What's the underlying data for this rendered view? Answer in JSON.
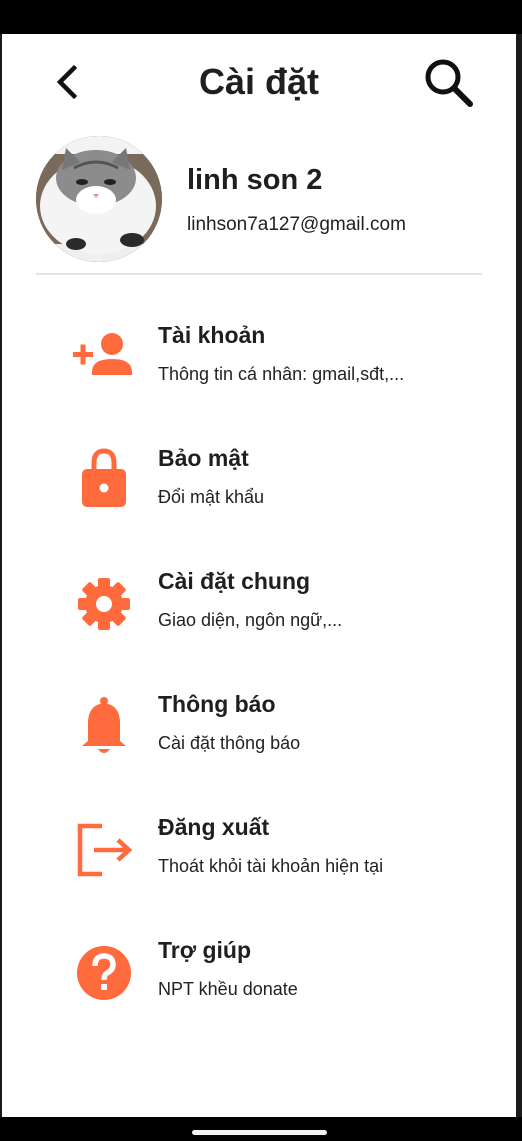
{
  "header": {
    "title": "Cài đặt",
    "back_icon": "back-arrow-icon",
    "search_icon": "search-icon"
  },
  "profile": {
    "name": "linh son 2",
    "email": "linhson7a127@gmail.com",
    "avatar": "cat-photo"
  },
  "accent_color": "#ff6b3d",
  "menu": {
    "items": [
      {
        "icon": "add-user-icon",
        "title": "Tài khoản",
        "subtitle": "Thông tin cá nhân: gmail,sđt,..."
      },
      {
        "icon": "lock-icon",
        "title": "Bảo mật",
        "subtitle": "Đổi mật khẩu"
      },
      {
        "icon": "gear-icon",
        "title": "Cài đặt chung",
        "subtitle": "Giao diện, ngôn ngữ,..."
      },
      {
        "icon": "bell-icon",
        "title": "Thông báo",
        "subtitle": "Cài đặt thông báo"
      },
      {
        "icon": "logout-icon",
        "title": "Đăng xuất",
        "subtitle": "Thoát khỏi tài khoản hiện tại"
      },
      {
        "icon": "help-icon",
        "title": "Trợ giúp",
        "subtitle": "NPT khều donate"
      }
    ]
  }
}
